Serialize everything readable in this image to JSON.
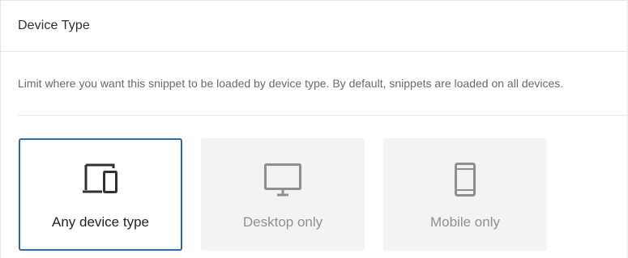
{
  "section": {
    "title": "Device Type",
    "description": "Limit where you want this snippet to be loaded by device type. By default, snippets are loaded on all devices."
  },
  "options": [
    {
      "label": "Any device type",
      "icon": "devices-icon",
      "selected": true
    },
    {
      "label": "Desktop only",
      "icon": "desktop-icon",
      "selected": false
    },
    {
      "label": "Mobile only",
      "icon": "mobile-icon",
      "selected": false
    }
  ],
  "colors": {
    "selected_border": "#2e6aa5",
    "option_bg": "#f3f3f3",
    "icon_dark": "#2c3338",
    "icon_muted": "#8c8f94"
  }
}
